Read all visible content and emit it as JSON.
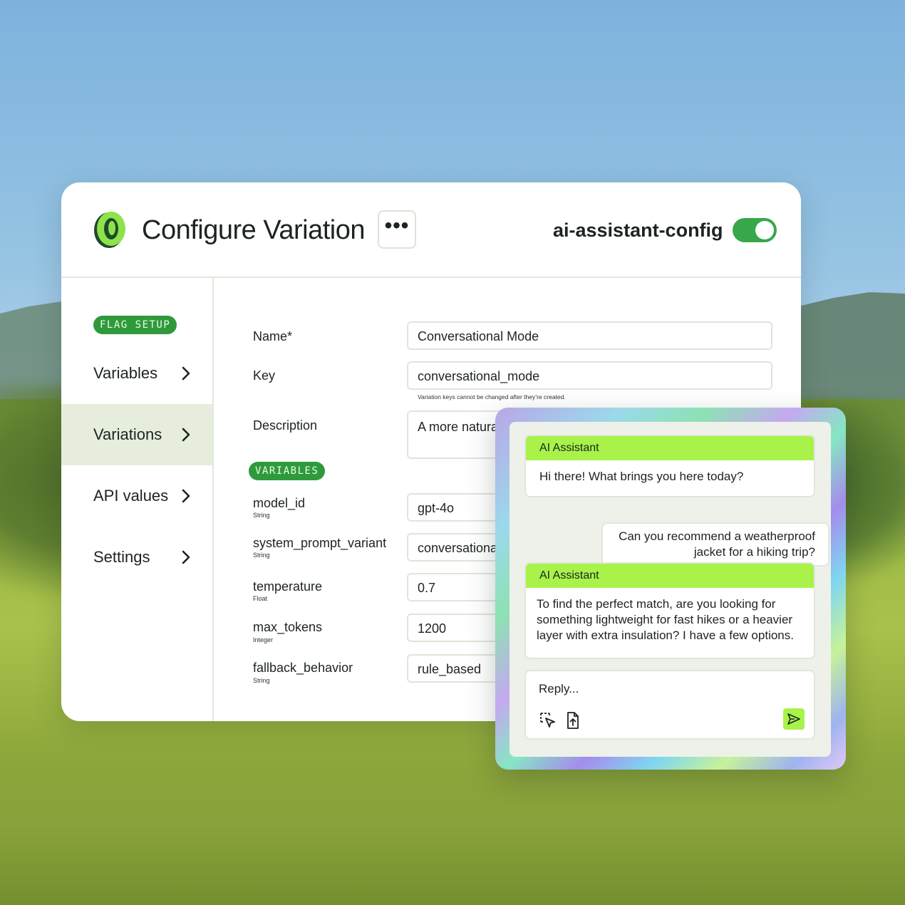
{
  "header": {
    "title": "Configure Variation",
    "more_icon": "more-horizontal-icon",
    "flag_key": "ai-assistant-config",
    "toggle_on": true,
    "accent": "#37a84a"
  },
  "sidebar": {
    "section_pill": "FLAG SETUP",
    "items": [
      {
        "label": "Variables",
        "active": false
      },
      {
        "label": "Variations",
        "active": true
      },
      {
        "label": "API values",
        "active": false
      },
      {
        "label": "Settings",
        "active": false
      }
    ]
  },
  "form": {
    "name_label": "Name*",
    "name_value": "Conversational Mode",
    "key_label": "Key",
    "key_value": "conversational_mode",
    "key_hint": "Variation keys cannot be changed after they’re created.",
    "description_label": "Description",
    "description_value": "A more natural tone with relaxed constraints",
    "variables_pill": "VARIABLES",
    "variables": [
      {
        "name": "model_id",
        "type": "String",
        "value": "gpt-4o"
      },
      {
        "name": "system_prompt_variant",
        "type": "String",
        "value": "conversational"
      },
      {
        "name": "temperature",
        "type": "Float",
        "value": "0.7"
      },
      {
        "name": "max_tokens",
        "type": "Integer",
        "value": "1200"
      },
      {
        "name": "fallback_behavior",
        "type": "String",
        "value": "rule_based"
      }
    ]
  },
  "chat": {
    "messages": [
      {
        "sender": "AI Assistant",
        "text": "Hi there! What brings you here today?"
      },
      {
        "sender": "user",
        "text": "Can you recommend a weatherproof jacket for a hiking trip?"
      },
      {
        "sender": "AI Assistant",
        "text": "To find the perfect match, are you looking for something lightweight for fast hikes or a heavier layer with extra insulation? I have a few options."
      }
    ],
    "reply_placeholder": "Reply...",
    "tools": [
      "cursor-select-icon",
      "file-upload-icon"
    ],
    "send_icon": "send-icon",
    "send_color": "#a8f24a"
  }
}
